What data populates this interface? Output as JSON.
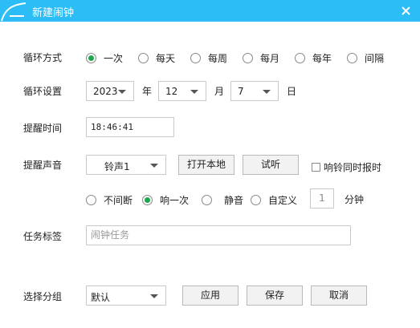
{
  "window": {
    "title": "新建闹钟",
    "close_icon": "close-icon",
    "title_color": "#2cbdf7"
  },
  "cycle_mode": {
    "label": "循环方式",
    "options": [
      "一次",
      "每天",
      "每周",
      "每月",
      "每年",
      "间隔"
    ],
    "selected": "一次"
  },
  "cycle_settings": {
    "label": "循环设置",
    "year": "2023",
    "year_unit": "年",
    "month": "12",
    "month_unit": "月",
    "day": "7",
    "day_unit": "日"
  },
  "reminder_time": {
    "label": "提醒时间",
    "value": "18:46:41"
  },
  "reminder_sound": {
    "label": "提醒声音",
    "sound": "铃声1",
    "open_local_label": "打开本地",
    "preview_label": "试听",
    "announce_time_label": "响铃同时报时",
    "announce_time_checked": false,
    "play_modes": [
      "不间断",
      "响一次",
      "静音",
      "自定义"
    ],
    "play_mode_selected": "响一次",
    "custom_minutes": "1",
    "minutes_unit": "分钟"
  },
  "task_label": {
    "label": "任务标签",
    "placeholder": "闹钟任务"
  },
  "group": {
    "label": "选择分组",
    "value": "默认"
  },
  "actions": {
    "apply_label": "应用",
    "save_label": "保存",
    "cancel_label": "取消"
  },
  "colors": {
    "accent": "#2cbdf7",
    "radio_selected": "#1ea64f"
  }
}
